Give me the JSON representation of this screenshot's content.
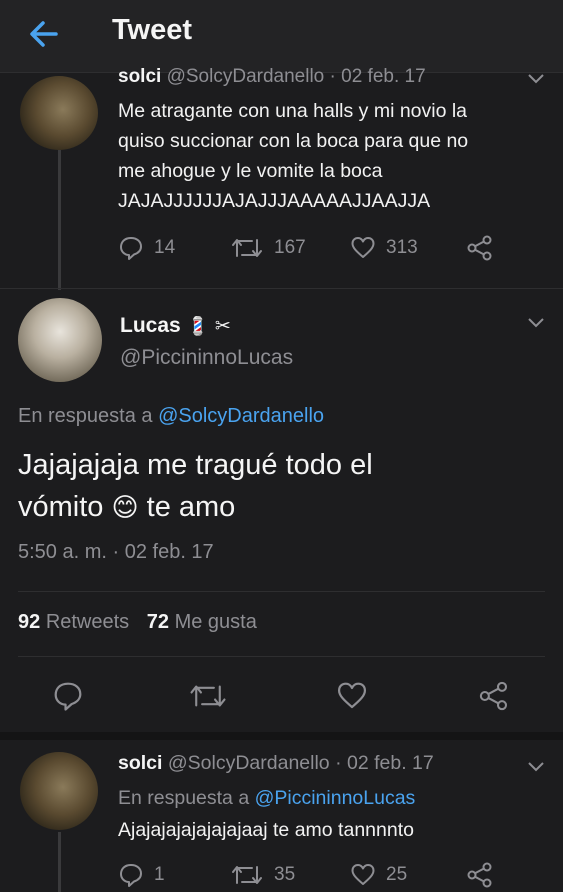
{
  "header": {
    "title": "Tweet"
  },
  "parent_tweet": {
    "name": "solci",
    "handle": "@SolcyDardanello",
    "date": "· 02 feb. 17",
    "text_lines": [
      "Me atragante con una halls y mi novio la",
      "quiso succionar con la boca para que no",
      "me ahogue  y le vomite la boca",
      "JAJAJJJJJJAJAJJJAAAAAJJAAJJA"
    ],
    "replies": "14",
    "retweets": "167",
    "likes": "313"
  },
  "main_tweet": {
    "name": "Lucas",
    "name_emoji": "💈",
    "name_symbol": "✂",
    "handle": "@PiccininnoLucas",
    "reply_prefix": "En respuesta a",
    "reply_to": "@SolcyDardanello",
    "text_line1": "Jajajajaja me tragué todo el",
    "text_line2_a": "vómito",
    "text_emoji": "😊",
    "text_line2_b": "te amo",
    "timestamp": "5:50 a. m. · 02 feb. 17",
    "retweet_count": "92",
    "retweet_label": "Retweets",
    "like_count": "72",
    "like_label": "Me gusta"
  },
  "reply_tweet": {
    "name": "solci",
    "handle": "@SolcyDardanello",
    "date": "· 02 feb. 17",
    "reply_prefix": "En respuesta a",
    "reply_to": "@PiccininnoLucas",
    "text": "Ajajajajajajajajaaj te amo tannnnto",
    "replies": "1",
    "retweets": "35",
    "likes": "25"
  },
  "colors": {
    "background": "#1c1c1e",
    "link": "#4aa3ef",
    "muted": "#8e8e93"
  }
}
